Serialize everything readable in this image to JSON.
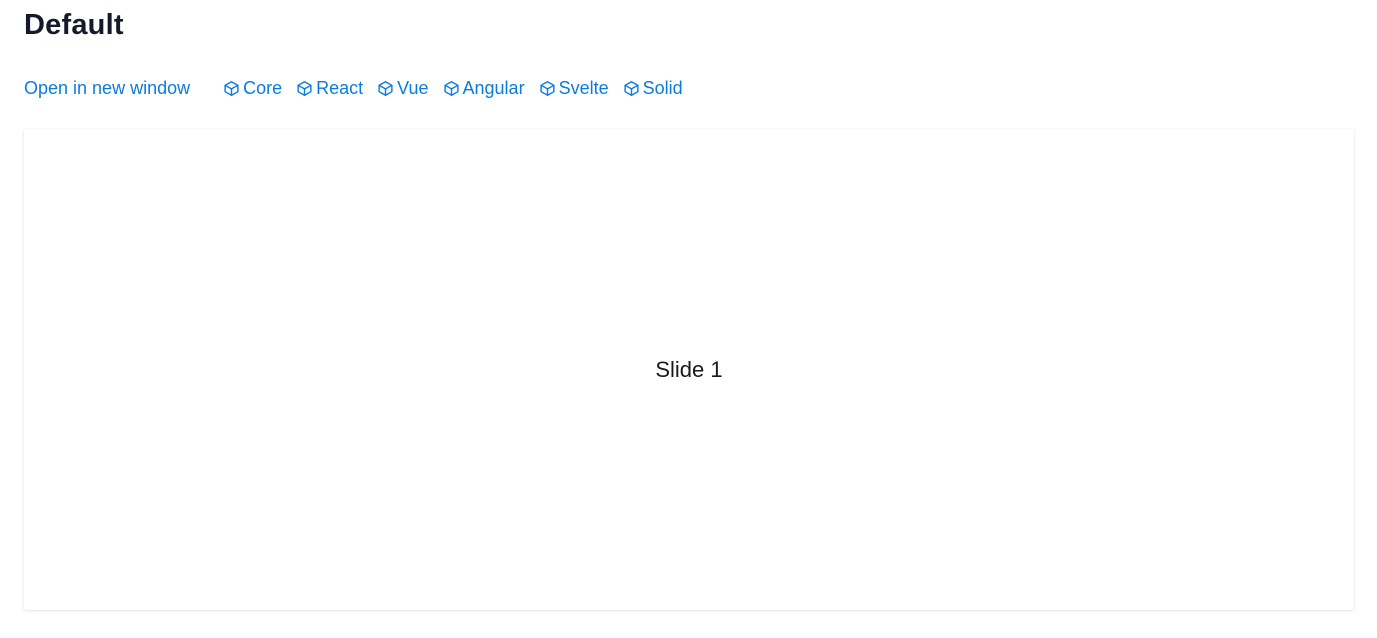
{
  "page": {
    "title": "Default"
  },
  "links": {
    "open_new_window": "Open in new window",
    "frameworks": [
      {
        "label": "Core",
        "icon": "cube-icon"
      },
      {
        "label": "React",
        "icon": "cube-icon"
      },
      {
        "label": "Vue",
        "icon": "cube-icon"
      },
      {
        "label": "Angular",
        "icon": "cube-icon"
      },
      {
        "label": "Svelte",
        "icon": "cube-icon"
      },
      {
        "label": "Solid",
        "icon": "cube-icon"
      }
    ]
  },
  "demo": {
    "slide_label": "Slide 1"
  },
  "colors": {
    "link": "#0a7ce0",
    "title": "#16192b"
  }
}
